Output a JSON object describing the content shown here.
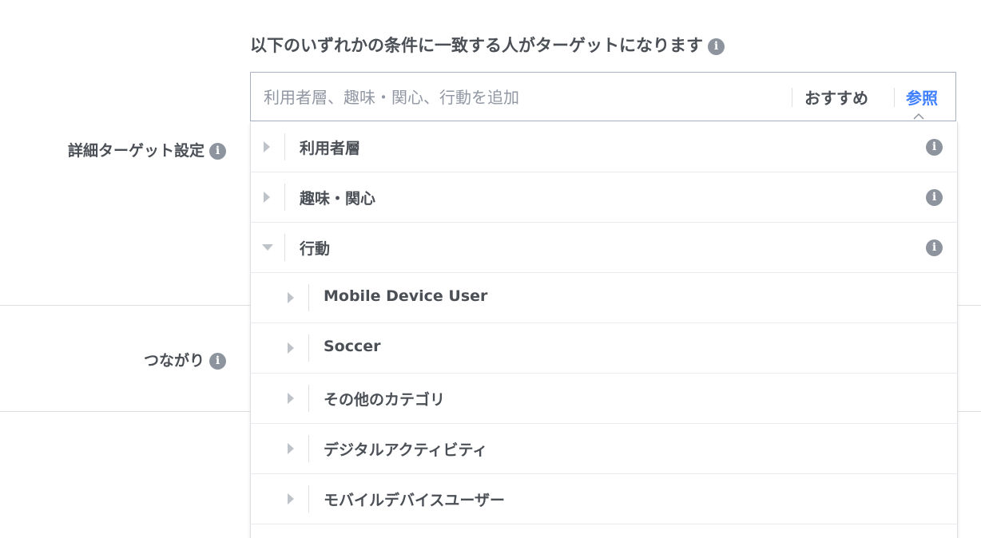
{
  "header": {
    "text": "以下のいずれかの条件に一致する人がターゲットになります",
    "info_icon": "info-icon"
  },
  "labels": {
    "detailed_targeting": "詳細ターゲット設定",
    "connections": "つながり"
  },
  "search": {
    "placeholder": "利用者層、趣味・関心、行動を追加",
    "value": "",
    "suggestions_label": "おすすめ",
    "browse_label": "参照",
    "accent_color": "#4080ff"
  },
  "dropdown": {
    "items": [
      {
        "label": "利用者層",
        "expanded": false,
        "level": 1,
        "has_info": true
      },
      {
        "label": "趣味・関心",
        "expanded": false,
        "level": 1,
        "has_info": true
      },
      {
        "label": "行動",
        "expanded": true,
        "level": 1,
        "has_info": true
      },
      {
        "label": "Mobile Device User",
        "expanded": false,
        "level": 2,
        "has_info": false
      },
      {
        "label": "Soccer",
        "expanded": false,
        "level": 2,
        "has_info": false
      },
      {
        "label": "その他のカテゴリ",
        "expanded": false,
        "level": 2,
        "has_info": false
      },
      {
        "label": "デジタルアクティビティ",
        "expanded": false,
        "level": 2,
        "has_info": false
      },
      {
        "label": "モバイルデバイスユーザー",
        "expanded": false,
        "level": 2,
        "has_info": false
      }
    ]
  }
}
